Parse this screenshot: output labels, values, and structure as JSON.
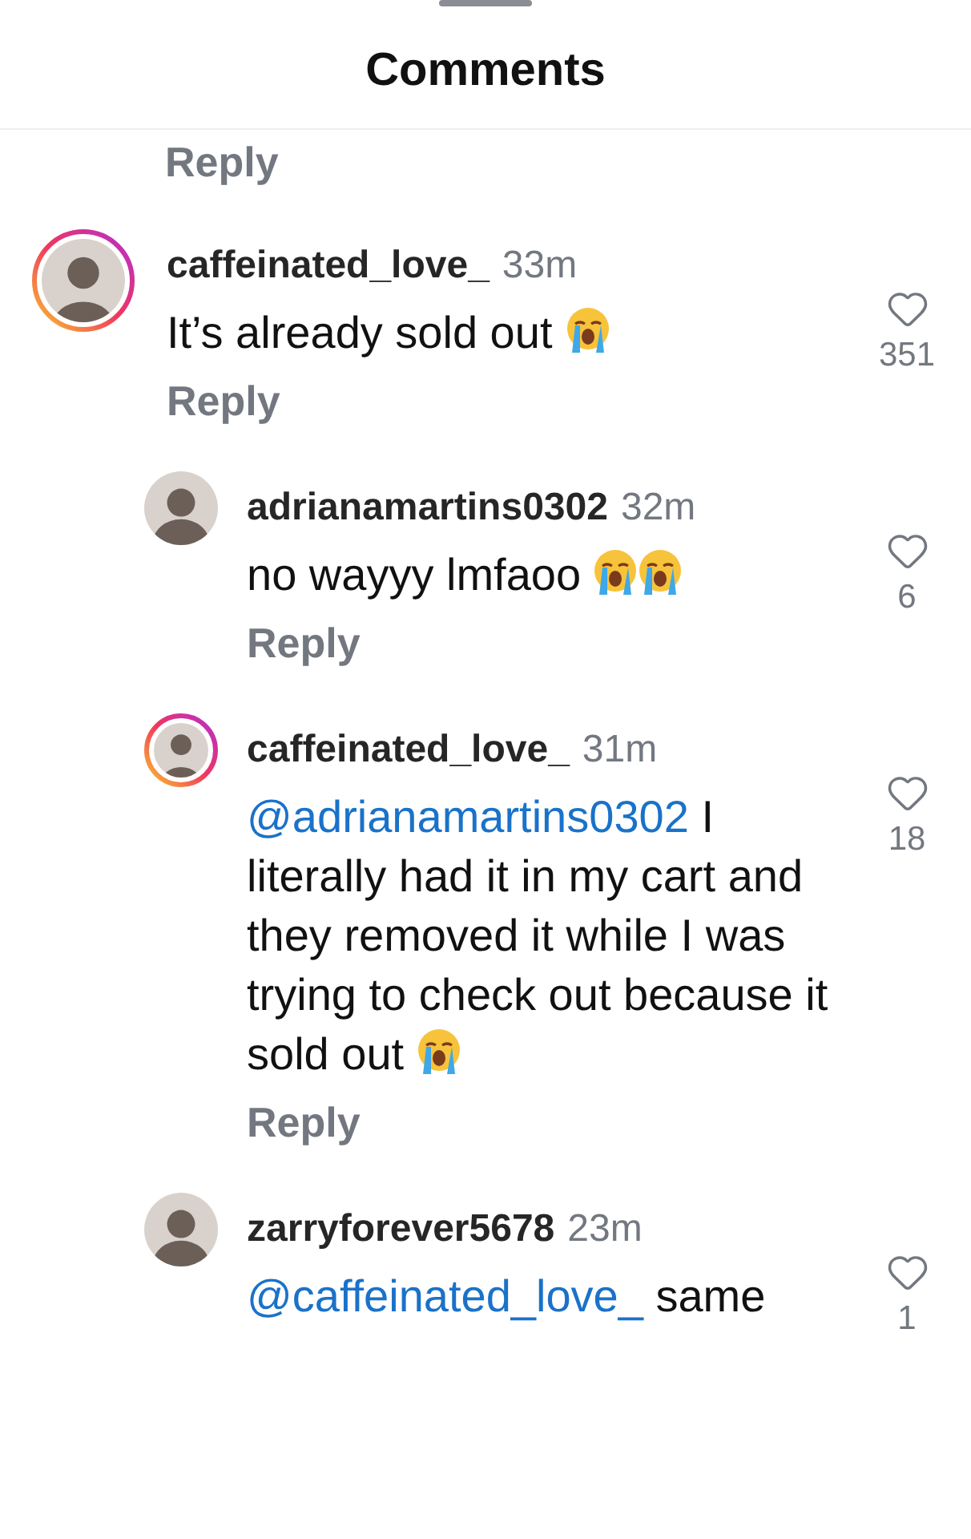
{
  "header": {
    "title": "Comments"
  },
  "previous_reply_label": "Reply",
  "comments": [
    {
      "username": "caffeinated_love_",
      "time": "33m",
      "story_ring": true,
      "body": [
        {
          "kind": "text",
          "text": "It’s already sold out "
        },
        {
          "kind": "emoji"
        }
      ],
      "reply_label": "Reply",
      "likes": "351",
      "replies": [
        {
          "username": "adrianamartins0302",
          "time": "32m",
          "story_ring": false,
          "body": [
            {
              "kind": "text",
              "text": "no wayyy lmfaoo "
            },
            {
              "kind": "emoji"
            },
            {
              "kind": "emoji"
            }
          ],
          "reply_label": "Reply",
          "likes": "6"
        },
        {
          "username": "caffeinated_love_",
          "time": "31m",
          "story_ring": true,
          "body": [
            {
              "kind": "mention",
              "text": "@adrianamartins0302"
            },
            {
              "kind": "text",
              "text": " I literally had it in my cart and they removed it while I was trying to check out because it sold out "
            },
            {
              "kind": "emoji"
            }
          ],
          "reply_label": "Reply",
          "likes": "18"
        },
        {
          "username": "zarryforever5678",
          "time": "23m",
          "story_ring": false,
          "body": [
            {
              "kind": "mention",
              "text": "@caffeinated_love_"
            },
            {
              "kind": "text",
              "text": " same"
            }
          ],
          "likes": "1"
        }
      ]
    }
  ]
}
